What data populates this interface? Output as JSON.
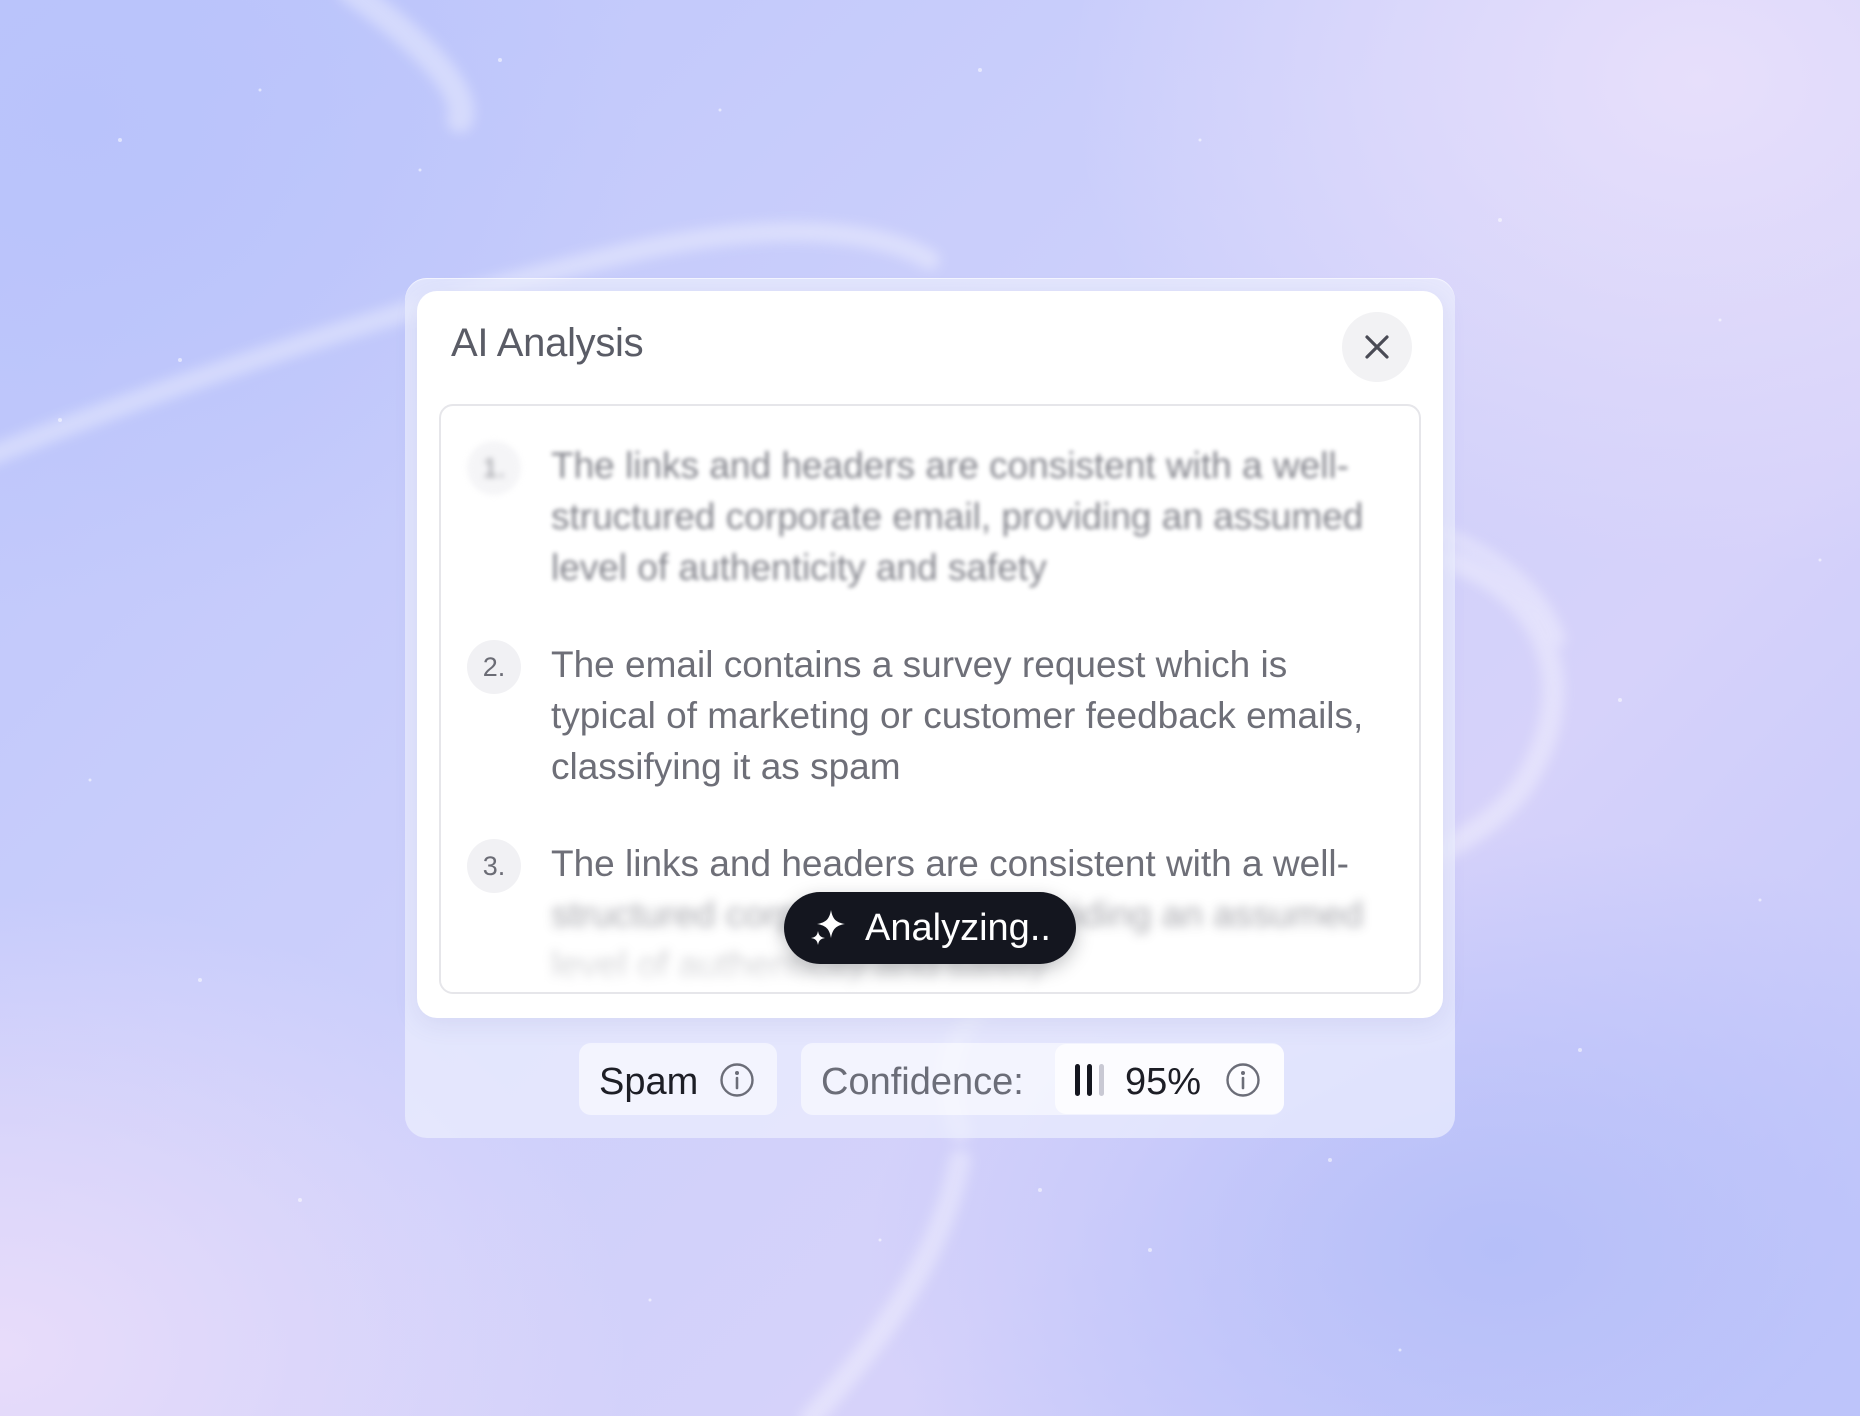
{
  "dialog": {
    "title": "AI Analysis",
    "close_icon": "close-icon",
    "points": [
      {
        "number": "1.",
        "text": "The links and headers are consistent with a well-structured corporate email, providing an assumed level of authenticity and safety"
      },
      {
        "number": "2.",
        "text": "The email contains a survey request which is typical of marketing or customer feedback emails, classifying it as spam"
      },
      {
        "number": "3.",
        "text_line1": "The links and headers are consistent with a well-",
        "text_rest": "structured corporate email, providing an assumed level of authenticity and safety"
      }
    ]
  },
  "status": {
    "label": "Analyzing..",
    "icon": "sparkle-icon"
  },
  "result": {
    "classification": "Spam",
    "confidence_label": "Confidence:",
    "confidence_value": "95%",
    "confidence_fraction": 0.95,
    "info_icon": "info-icon"
  },
  "colors": {
    "background_start": "#bcc5fb",
    "background_end": "#e7dffb",
    "card": "#ffffff",
    "pill": "#14161f",
    "text": "#6e6f78"
  }
}
